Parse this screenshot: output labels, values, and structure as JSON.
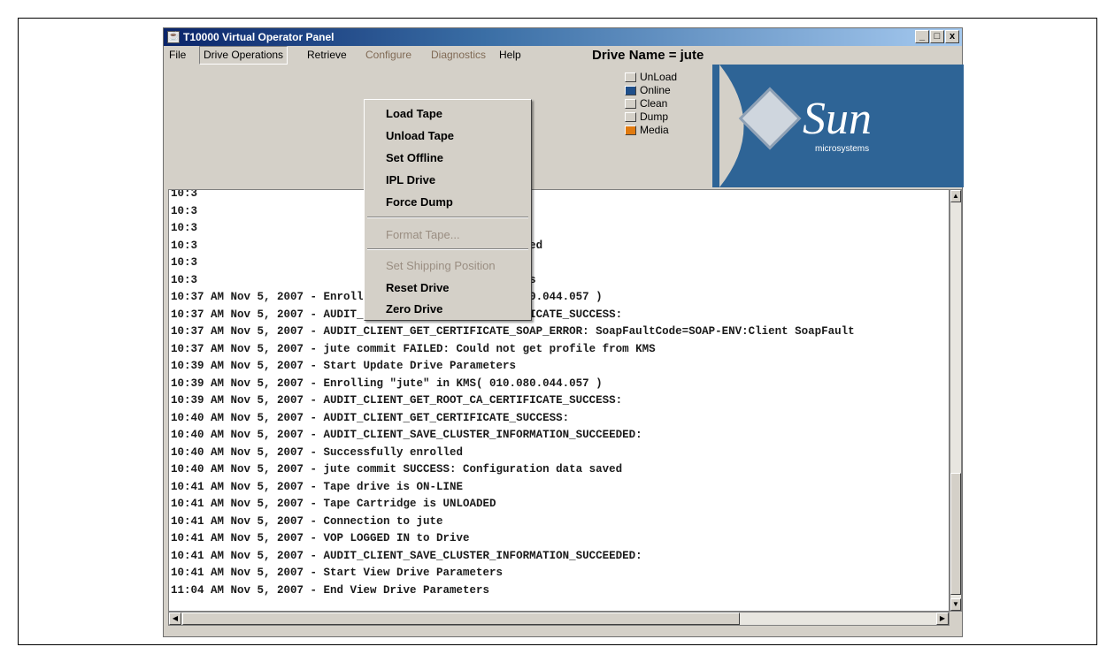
{
  "window": {
    "title": "T10000 Virtual Operator Panel",
    "controls": {
      "minimize": "_",
      "maximize": "□",
      "close": "x"
    }
  },
  "menubar": {
    "items": [
      "File",
      "Drive Operations",
      "Retrieve",
      "Configure",
      "Diagnostics",
      "Help"
    ],
    "drive_name": "Drive Name = jute"
  },
  "drive_operations_menu": {
    "items": [
      {
        "label": "Load Tape",
        "enabled": true
      },
      {
        "label": "Unload Tape",
        "enabled": true
      },
      {
        "label": "Set Offline",
        "enabled": true
      },
      {
        "label": "IPL Drive",
        "enabled": true
      },
      {
        "label": "Force Dump",
        "enabled": true
      },
      {
        "label": "Format Tape...",
        "enabled": false
      },
      {
        "label": "Set Shipping Position",
        "enabled": false
      },
      {
        "label": "Reset Drive",
        "enabled": true
      },
      {
        "label": "Zero Drive",
        "enabled": true
      }
    ]
  },
  "indicators": [
    {
      "label": "UnLoad",
      "color": "#d4d0c8"
    },
    {
      "label": "Online",
      "color": "#1f4f8a"
    },
    {
      "label": "Clean",
      "color": "#d4d0c8"
    },
    {
      "label": "Dump",
      "color": "#d4d0c8"
    },
    {
      "label": "Media",
      "color": "#e07a10"
    }
  ],
  "logo": {
    "brand": "Sun",
    "subtitle": "microsystems",
    "brand_color": "#2e6496"
  },
  "log": {
    "lines": [
      "10:3                          LOGGED IN to Drive",
      "10:3                          t View Drive Parameters",
      "10:3                          View Drive Parameters",
      "10:3                          OFF-LINE Operation Started",
      "10:3                          e drive is OFF-LINE",
      "10:3                          t Update Drive Parameters",
      "10:37 AM Nov 5, 2007 - Enrolling \"jute\" in KMS( 010.080.044.057 )",
      "10:37 AM Nov 5, 2007 - AUDIT_CLIENT_GET_ROOT_CA_CERTIFICATE_SUCCESS:",
      "10:37 AM Nov 5, 2007 - AUDIT_CLIENT_GET_CERTIFICATE_SOAP_ERROR: SoapFaultCode=SOAP-ENV:Client SoapFault",
      "10:37 AM Nov 5, 2007 - jute commit FAILED: Could not get profile from KMS",
      "10:39 AM Nov 5, 2007 - Start Update Drive Parameters",
      "10:39 AM Nov 5, 2007 - Enrolling \"jute\" in KMS( 010.080.044.057 )",
      "10:39 AM Nov 5, 2007 - AUDIT_CLIENT_GET_ROOT_CA_CERTIFICATE_SUCCESS:",
      "10:40 AM Nov 5, 2007 - AUDIT_CLIENT_GET_CERTIFICATE_SUCCESS:",
      "10:40 AM Nov 5, 2007 - AUDIT_CLIENT_SAVE_CLUSTER_INFORMATION_SUCCEEDED:",
      "10:40 AM Nov 5, 2007 - Successfully enrolled",
      "10:40 AM Nov 5, 2007 - jute commit SUCCESS: Configuration data saved",
      "10:41 AM Nov 5, 2007 - Tape drive is ON-LINE",
      "10:41 AM Nov 5, 2007 - Tape Cartridge is UNLOADED",
      "10:41 AM Nov 5, 2007 - Connection to jute",
      "10:41 AM Nov 5, 2007 - VOP LOGGED IN to Drive",
      "10:41 AM Nov 5, 2007 - AUDIT_CLIENT_SAVE_CLUSTER_INFORMATION_SUCCEEDED:",
      "10:41 AM Nov 5, 2007 - Start View Drive Parameters",
      "11:04 AM Nov 5, 2007 - End View Drive Parameters"
    ]
  }
}
